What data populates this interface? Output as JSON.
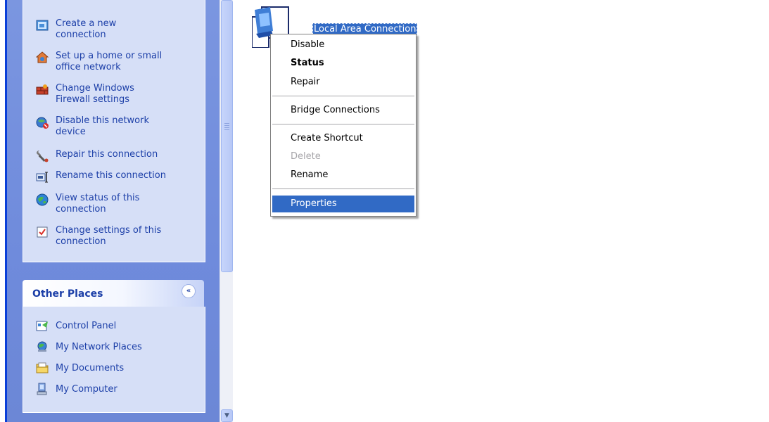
{
  "network_tasks": [
    {
      "label_1": "Create a new",
      "label_2": "connection",
      "icon": "new-connection-icon"
    },
    {
      "label_1": "Set up a home or small",
      "label_2": "office network",
      "icon": "home-network-icon"
    },
    {
      "label_1": "Change Windows",
      "label_2": "Firewall settings",
      "icon": "firewall-icon"
    },
    {
      "label_1": "Disable this network",
      "label_2": "device",
      "icon": "disable-device-icon"
    },
    {
      "label_1": "Repair this connection",
      "icon": "wrench-icon"
    },
    {
      "label_1": "Rename this connection",
      "icon": "rename-icon"
    },
    {
      "label_1": "View status of this",
      "label_2": "connection",
      "icon": "status-icon"
    },
    {
      "label_1": "Change settings of this",
      "label_2": "connection",
      "icon": "settings-icon"
    }
  ],
  "other_places": {
    "title": "Other Places",
    "toggle": "«",
    "items": [
      {
        "label": "Control Panel",
        "icon": "control-panel-icon"
      },
      {
        "label": "My Network Places",
        "icon": "network-places-icon"
      },
      {
        "label": "My Documents",
        "icon": "folder-icon"
      },
      {
        "label": "My Computer",
        "icon": "computer-icon"
      }
    ]
  },
  "connection": {
    "label": "Local Area Connection",
    "icon": "network-connection-icon"
  },
  "context_menu": {
    "items": [
      {
        "label": "Disable",
        "bold": false,
        "disabled": false
      },
      {
        "label": "Status",
        "bold": true,
        "disabled": false
      },
      {
        "label": "Repair",
        "bold": false,
        "disabled": false
      },
      {
        "label": "Bridge Connections",
        "bold": false,
        "disabled": false
      },
      {
        "label": "Create Shortcut",
        "bold": false,
        "disabled": false
      },
      {
        "label": "Delete",
        "bold": false,
        "disabled": true
      },
      {
        "label": "Rename",
        "bold": false,
        "disabled": false
      },
      {
        "label": "Properties",
        "bold": false,
        "disabled": false,
        "highlighted": true
      }
    ]
  },
  "colors": {
    "pane_blue": "#6f8bdc",
    "link_blue": "#1c3fa8",
    "selection_blue": "#316ac5"
  }
}
